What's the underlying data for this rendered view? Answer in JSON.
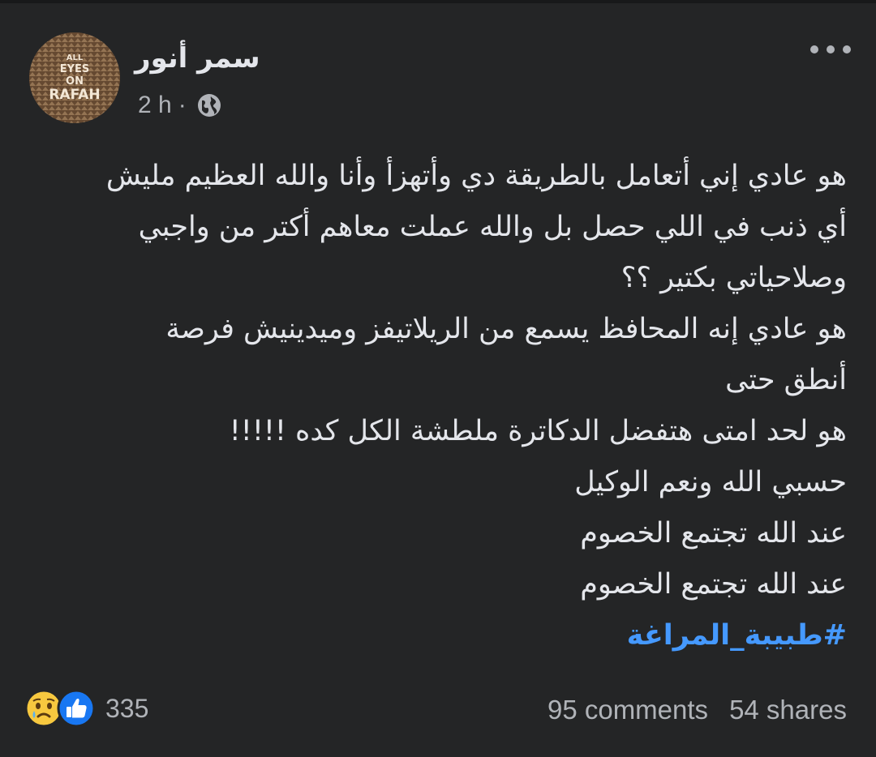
{
  "post": {
    "author": "سمر أنور",
    "time": "2 h",
    "separator": "·",
    "privacy_icon": "globe-icon",
    "avatar_text": [
      "ALL",
      "EYES",
      "ON",
      "RAFAH"
    ],
    "lines": [
      "هو عادي إني أتعامل بالطريقة دي وأتهزأ وأنا والله العظيم مليش",
      "أي ذنب في اللي حصل بل والله عملت معاهم أكتر من واجبي",
      "وصلاحياتي بكتير ؟؟",
      "هو عادي إنه المحافظ يسمع من الريلاتيفز وميدينيش فرصة",
      "أنطق حتى",
      "هو لحد امتى هتفضل الدكاترة ملطشة الكل كده !!!!!",
      "حسبي الله ونعم الوكيل",
      "عند الله تجتمع الخصوم",
      "عند الله تجتمع الخصوم"
    ],
    "hashtag": "#طبيبة_المراغة"
  },
  "footer": {
    "reaction_icons": [
      "sad-reaction-icon",
      "like-reaction-icon"
    ],
    "reaction_count": "335",
    "comments": "95 comments",
    "shares": "54 shares"
  },
  "colors": {
    "background": "#242526",
    "text": "#e4e6eb",
    "muted": "#b0b3b8",
    "link": "#4599ff",
    "like_blue": "#1877f2",
    "sad_yellow": "#f7c83f"
  }
}
